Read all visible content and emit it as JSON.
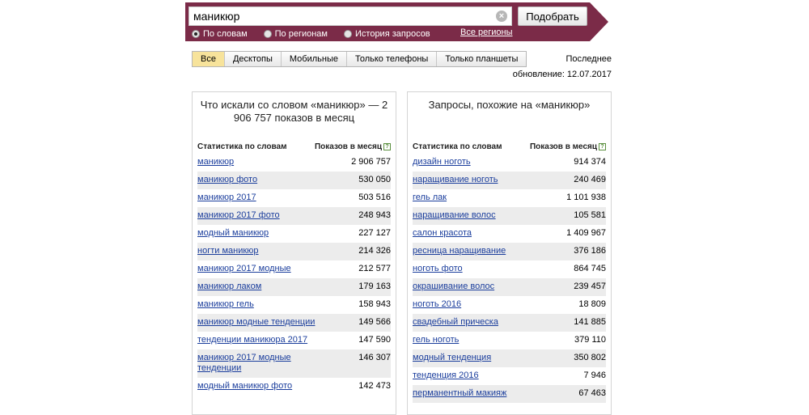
{
  "search": {
    "query": "маникюр",
    "button_label": "Подобрать",
    "clear_glyph": "×",
    "modes": [
      {
        "label": "По словам",
        "checked": true
      },
      {
        "label": "По регионам",
        "checked": false
      },
      {
        "label": "История запросов",
        "checked": false
      }
    ],
    "regions_link": "Все регионы"
  },
  "tabs": [
    {
      "label": "Все",
      "active": true
    },
    {
      "label": "Десктопы",
      "active": false
    },
    {
      "label": "Мобильные",
      "active": false
    },
    {
      "label": "Только телефоны",
      "active": false
    },
    {
      "label": "Только планшеты",
      "active": false
    }
  ],
  "update": {
    "line1": "Последнее",
    "line2": "обновление: 12.07.2017"
  },
  "left_panel": {
    "title": "Что искали со словом «маникюр» — 2 906 757 показов в месяц",
    "col_keyword": "Статистика по словам",
    "col_count": "Показов в месяц",
    "help_glyph": "?",
    "rows": [
      {
        "keyword": "маникюр",
        "count": "2 906 757"
      },
      {
        "keyword": "маникюр фото",
        "count": "530 050"
      },
      {
        "keyword": "маникюр 2017",
        "count": "503 516"
      },
      {
        "keyword": "маникюр 2017 фото",
        "count": "248 943"
      },
      {
        "keyword": "модный маникюр",
        "count": "227 127"
      },
      {
        "keyword": "ногти маникюр",
        "count": "214 326"
      },
      {
        "keyword": "маникюр 2017 модные",
        "count": "212 577"
      },
      {
        "keyword": "маникюр лаком",
        "count": "179 163"
      },
      {
        "keyword": "маникюр гель",
        "count": "158 943"
      },
      {
        "keyword": "маникюр модные тенденции",
        "count": "149 566"
      },
      {
        "keyword": "тенденции маникюра 2017",
        "count": "147 590"
      },
      {
        "keyword": "маникюр 2017 модные тенденции",
        "count": "146 307"
      },
      {
        "keyword": "модный маникюр фото",
        "count": "142 473"
      }
    ]
  },
  "right_panel": {
    "title": "Запросы, похожие на «маникюр»",
    "col_keyword": "Статистика по словам",
    "col_count": "Показов в месяц",
    "help_glyph": "?",
    "rows": [
      {
        "keyword": "дизайн ноготь",
        "count": "914 374"
      },
      {
        "keyword": "наращивание ноготь",
        "count": "240 469"
      },
      {
        "keyword": "гель лак",
        "count": "1 101 938"
      },
      {
        "keyword": "наращивание волос",
        "count": "105 581"
      },
      {
        "keyword": "салон красота",
        "count": "1 409 967"
      },
      {
        "keyword": "ресница наращивание",
        "count": "376 186"
      },
      {
        "keyword": "ноготь фото",
        "count": "864 745"
      },
      {
        "keyword": "окрашивание волос",
        "count": "239 457"
      },
      {
        "keyword": "ноготь 2016",
        "count": "18 809"
      },
      {
        "keyword": "свадебный прическа",
        "count": "141 885"
      },
      {
        "keyword": "гель ноготь",
        "count": "379 110"
      },
      {
        "keyword": "модный тенденция",
        "count": "350 802"
      },
      {
        "keyword": "тенденция 2016",
        "count": "7 946"
      },
      {
        "keyword": "перманентный макияж",
        "count": "67 463"
      }
    ]
  },
  "colors": {
    "header_bg": "#7b2b48",
    "link": "#1a3d9c",
    "active_tab": "#f7e39b",
    "row_stripe": "#ececec"
  }
}
